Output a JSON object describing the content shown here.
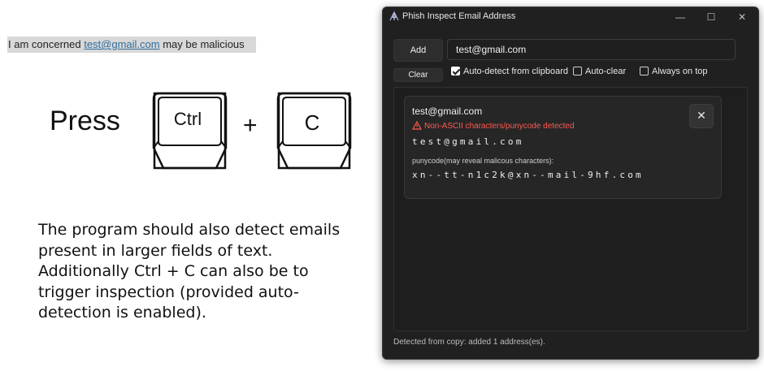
{
  "slide": {
    "highlight_prefix": "I am concerned ",
    "highlight_email": "test@gmail.com",
    "highlight_suffix": " may be malicious",
    "press_word": "Press",
    "key_ctrl": "Ctrl",
    "plus": "+",
    "key_c": "C",
    "explanation": "The program should also detect emails present in larger fields of text. Additionally Ctrl + C can also be to trigger inspection (provided auto-detection is enabled)."
  },
  "app": {
    "title": "Phish Inspect Email Address",
    "window_controls": {
      "minimize": "—",
      "maximize": "☐",
      "close": "✕"
    },
    "add_label": "Add",
    "input_value": "test@gmail.com",
    "clear_label": "Clear",
    "options": {
      "autodetect_label": "Auto-detect from clipboard",
      "autodetect_checked": true,
      "autoclear_label": "Auto-clear",
      "autoclear_checked": false,
      "ontop_label": "Always on top",
      "ontop_checked": false
    },
    "result": {
      "email": "test@gmail.com",
      "warning": "Non-ASCII characters/punycode detected",
      "spaced_email": "test@gmail.com",
      "puny_label": "punycode(may reveal malicous characters):",
      "punycode": "xn--tt-n1c2k@xn--mail-9hf.com",
      "close_glyph": "✕"
    },
    "status": "Detected from copy: added 1 address(es).",
    "colors": {
      "window_bg": "#202020",
      "warning": "#ff5a4f",
      "link": "#2f6e9e"
    },
    "icons": [
      "app-icon",
      "warning-icon",
      "close-icon",
      "minimize-icon",
      "maximize-icon"
    ]
  }
}
